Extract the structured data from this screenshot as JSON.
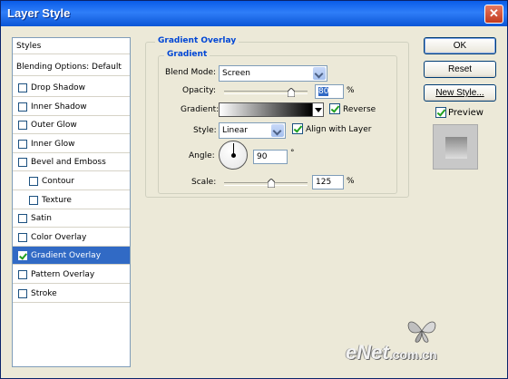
{
  "window": {
    "title": "Layer Style",
    "close_glyph": "✕"
  },
  "styles_list": {
    "header": "Styles",
    "blending": "Blending Options: Default",
    "items": [
      {
        "label": "Drop Shadow",
        "checked": false,
        "indent": false
      },
      {
        "label": "Inner Shadow",
        "checked": false,
        "indent": false
      },
      {
        "label": "Outer Glow",
        "checked": false,
        "indent": false
      },
      {
        "label": "Inner Glow",
        "checked": false,
        "indent": false
      },
      {
        "label": "Bevel and Emboss",
        "checked": false,
        "indent": false
      },
      {
        "label": "Contour",
        "checked": false,
        "indent": true
      },
      {
        "label": "Texture",
        "checked": false,
        "indent": true
      },
      {
        "label": "Satin",
        "checked": false,
        "indent": false
      },
      {
        "label": "Color Overlay",
        "checked": false,
        "indent": false
      },
      {
        "label": "Gradient Overlay",
        "checked": true,
        "indent": false,
        "selected": true
      },
      {
        "label": "Pattern Overlay",
        "checked": false,
        "indent": false
      },
      {
        "label": "Stroke",
        "checked": false,
        "indent": false
      }
    ]
  },
  "panel": {
    "group_title": "Gradient Overlay",
    "inner_title": "Gradient",
    "blend_mode": {
      "label": "Blend Mode:",
      "value": "Screen"
    },
    "opacity": {
      "label": "Opacity:",
      "value": "80",
      "unit": "%",
      "level": 0.8
    },
    "gradient": {
      "label": "Gradient:",
      "reverse_label": "Reverse",
      "reverse_checked": true
    },
    "style": {
      "label": "Style:",
      "value": "Linear",
      "align_label": "Align with Layer",
      "align_checked": true
    },
    "angle": {
      "label": "Angle:",
      "value": "90",
      "unit": "°"
    },
    "scale": {
      "label": "Scale:",
      "value": "125",
      "unit": "%",
      "level": 0.56
    }
  },
  "buttons": {
    "ok": "OK",
    "reset": "Reset",
    "new_style": "New Style...",
    "preview": "Preview",
    "preview_checked": true
  },
  "watermark": {
    "main": "eNet",
    "tld": ".com.cn"
  },
  "colors": {
    "title_bar": "#0a5ce8",
    "selection": "#316ac5",
    "group_title": "#0046d5",
    "check_mark": "#21a121"
  }
}
